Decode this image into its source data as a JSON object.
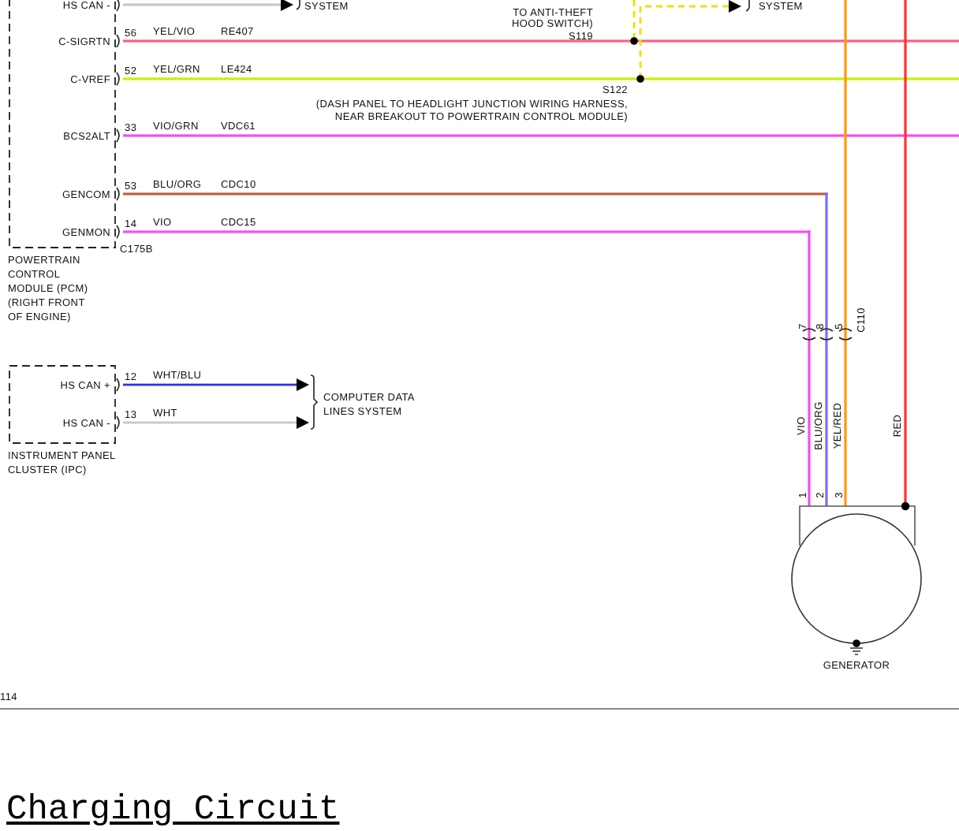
{
  "diagram": {
    "system_labels": [
      "SYSTEM",
      "SYSTEM"
    ],
    "pcm": {
      "label_lines": [
        "POWERTRAIN",
        "CONTROL",
        "MODULE (PCM)",
        "(RIGHT FRONT",
        "OF ENGINE)"
      ],
      "connector": "C175B",
      "circuits": [
        {
          "pin_name": "HS CAN -",
          "color": "#c8c8c8"
        },
        {
          "pin_name": "C-SIGRTN",
          "pin": "56",
          "wire": "YEL/VIO",
          "circuit": "RE407",
          "color": "#ff6080"
        },
        {
          "pin_name": "C-VREF",
          "pin": "52",
          "wire": "YEL/GRN",
          "circuit": "LE424",
          "color": "#c8f000"
        },
        {
          "pin_name": "BCS2ALT",
          "pin": "33",
          "wire": "VIO/GRN",
          "circuit": "VDC61",
          "color": "#f050f0"
        },
        {
          "pin_name": "GENCOM",
          "pin": "53",
          "wire": "BLU/ORG",
          "circuit": "CDC10",
          "color": "#c06040"
        },
        {
          "pin_name": "GENMON",
          "pin": "14",
          "wire": "VIO",
          "circuit": "CDC15",
          "color": "#f050f0"
        }
      ]
    },
    "splices": [
      {
        "lines": [
          "TO ANTI-THEFT",
          "HOOD SWITCH)"
        ],
        "id": "S119"
      },
      {
        "id": "S122",
        "lines": [
          "(DASH PANEL TO HEADLIGHT JUNCTION WIRING HARNESS,",
          "NEAR BREAKOUT TO POWERTRAIN CONTROL MODULE)"
        ]
      }
    ],
    "ipc": {
      "label_lines": [
        "INSTRUMENT PANEL",
        "CLUSTER (IPC)"
      ],
      "circuits": [
        {
          "pin_name": "HS CAN +",
          "pin": "12",
          "wire": "WHT/BLU",
          "color": "#3030ee"
        },
        {
          "pin_name": "HS CAN -",
          "pin": "13",
          "wire": "WHT",
          "color": "#c8c8c8"
        }
      ],
      "destination_lines": [
        "COMPUTER DATA",
        "LINES SYSTEM"
      ]
    },
    "generator": {
      "connector": "C110",
      "inline_pins": [
        "7",
        "8",
        "5"
      ],
      "wires": [
        {
          "label": "VIO",
          "color": "#f050f0"
        },
        {
          "label": "BLU/ORG",
          "color": "#7070ff"
        },
        {
          "label": "YEL/RED",
          "color": "#ff9900"
        },
        {
          "label": "RED",
          "color": "#ff3030"
        }
      ],
      "pins": [
        "1",
        "2",
        "3"
      ],
      "label": "GENERATOR"
    },
    "page_number": "114"
  },
  "heading": "Charging Circuit"
}
